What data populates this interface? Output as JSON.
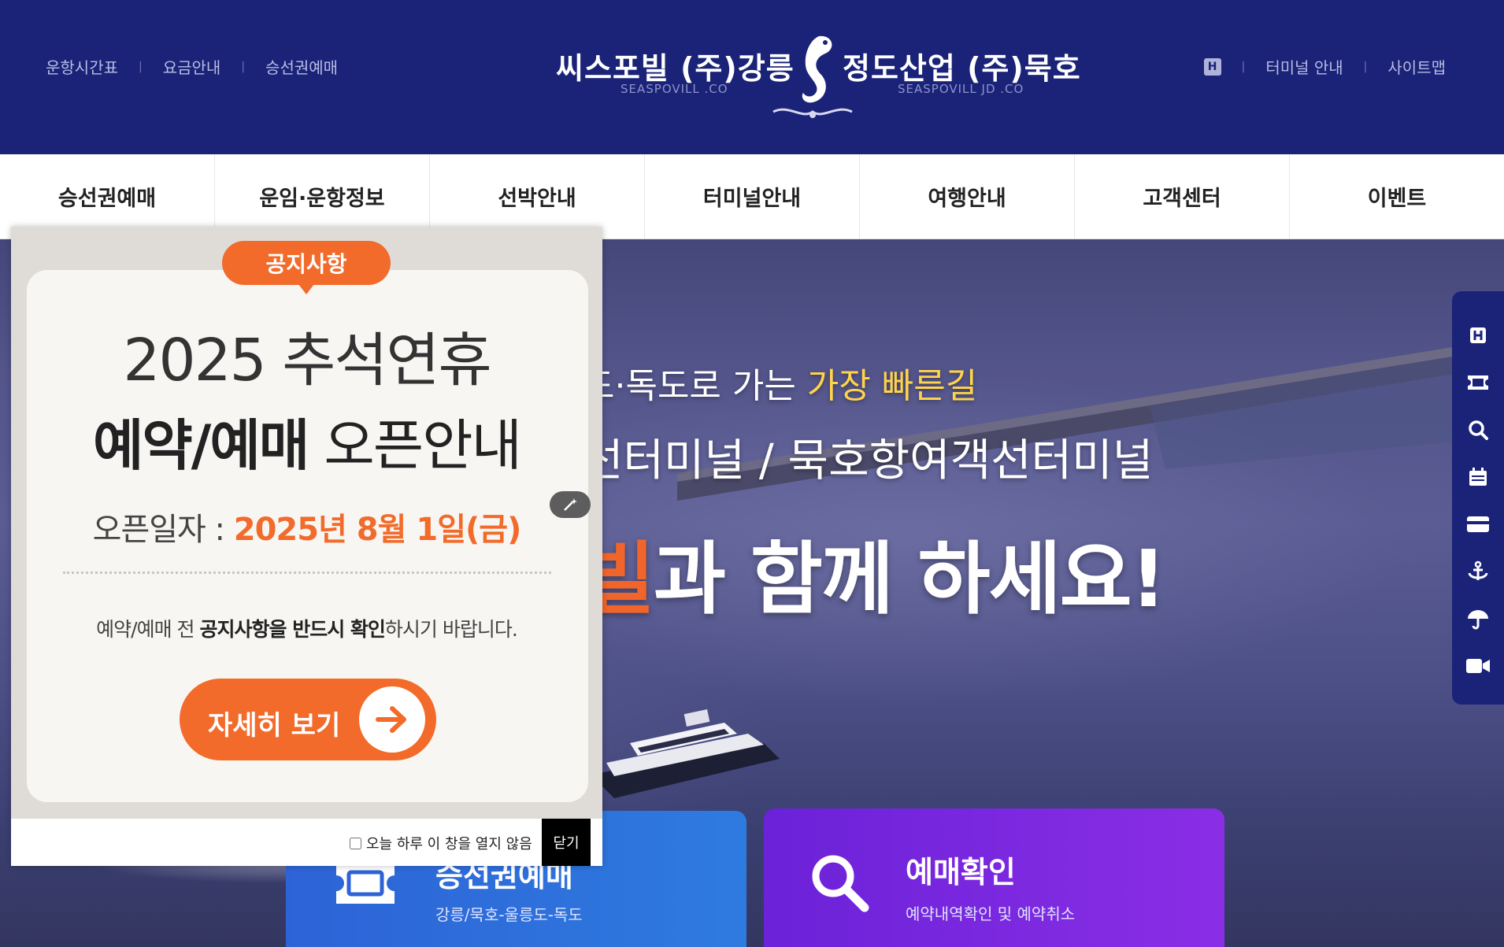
{
  "header": {
    "util_left": [
      "운항시간표",
      "요금안내",
      "승선권예매"
    ],
    "h_badge": "H",
    "util_right": [
      "터미널 안내",
      "사이트맵"
    ],
    "logo": {
      "left_name": "씨스포빌 (주)강릉",
      "left_sub": "SEASPOVILL .CO",
      "right_name": "정도산업 (주)묵호",
      "right_sub": "SEASPOVILL JD .CO"
    }
  },
  "nav": [
    "승선권예매",
    "운임·운항정보",
    "선박안내",
    "터미널안내",
    "여행안내",
    "고객센터",
    "이벤트"
  ],
  "hero": {
    "line1_prefix": "도·독도로 가는 ",
    "line1_highlight": "가장 빠른길",
    "line2": "선터미널 / 묵호항여객선터미널",
    "line3_accent": "빌",
    "line3_rest": "과 함께 하세요!"
  },
  "cards": {
    "ticket_title": "승선권예매",
    "ticket_sub": "강릉/묵호-울릉도-독도",
    "check_title": "예매확인",
    "check_sub": "예약내역확인 및 예약취소"
  },
  "quickbar_icons": [
    "h-icon",
    "ticket-icon",
    "search-icon",
    "calendar-icon",
    "card-icon",
    "anchor-icon",
    "umbrella-icon",
    "video-icon"
  ],
  "popup": {
    "tag": "공지사항",
    "title_line1": "2025 추석연휴",
    "title_bold": "예약/예매",
    "title_rest": " 오픈안내",
    "date_label": "오픈일자 : ",
    "date_value": "2025년 8월 1일(금)",
    "msg_pre": "예약/예매 전 ",
    "msg_bold": "공지사항을 반드시 확인",
    "msg_post": "하시기 바랍니다.",
    "button": "자세히 보기",
    "checkbox_label": "오늘 하루 이 창을 열지 않음",
    "close": "닫기"
  },
  "colors": {
    "header_bg": "#1b2379",
    "accent_orange": "#f26b2b",
    "highlight_yellow": "#ffd34a",
    "card_blue": "#2d63d6",
    "card_purple": "#6b22d8"
  }
}
